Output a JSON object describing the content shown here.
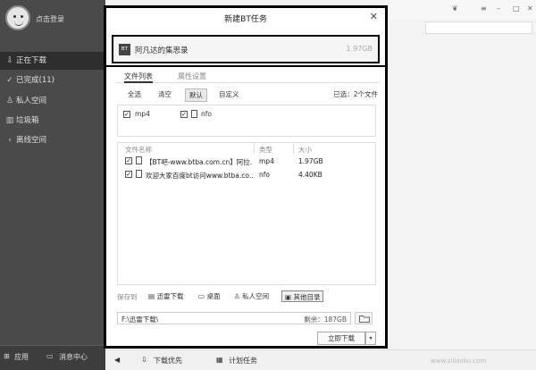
{
  "sidebar": {
    "login_label": "点击登录",
    "items": [
      {
        "icon": "download-icon",
        "label": "正在下载"
      },
      {
        "icon": "check-circle-icon",
        "label": "已完成(11)"
      },
      {
        "icon": "user-icon",
        "label": "私人空间"
      },
      {
        "icon": "trash-icon",
        "label": "垃圾箱"
      },
      {
        "icon": "chevron-right-icon",
        "label": "离线空间"
      }
    ],
    "bottom": {
      "apps_label": "应用",
      "messages_label": "消息中心"
    }
  },
  "dialog": {
    "title": "新建BT任务",
    "close_glyph": "✕",
    "torrent_icon_text": "BT",
    "torrent_name": "阿凡达的集思录",
    "torrent_size": "1.97GB",
    "tabs": [
      "文件列表",
      "属性设置"
    ],
    "filters": [
      "全选",
      "清空",
      "默认",
      "自定义"
    ],
    "selected_count": "已选：2个文件",
    "file_types": [
      {
        "label": "mp4",
        "checked": true
      },
      {
        "label": "nfo",
        "checked": true
      }
    ],
    "columns": [
      "文件名称",
      "类型",
      "大小"
    ],
    "files": [
      {
        "name": "【BT吧-www.btba.com.cn】阿拉...",
        "type": "mp4",
        "size": "1.97GB",
        "checked": true
      },
      {
        "name": "欢迎大家百度bt访问www.btba.co...",
        "type": "nfo",
        "size": "4.40KB",
        "checked": true
      }
    ],
    "save_label": "保存到",
    "save_options": [
      "迅雷下载",
      "桌面",
      "私人空间",
      "其他目录"
    ],
    "path": "F:\\迅雷下载\\",
    "free_space": "剩余：187GB",
    "download_button": "立即下载",
    "download_arrow": "▾"
  },
  "bottom_bar": {
    "priority_label": "下载优先",
    "plan_label": "计划任务"
  },
  "watermark": "www.ziliaoku.com"
}
